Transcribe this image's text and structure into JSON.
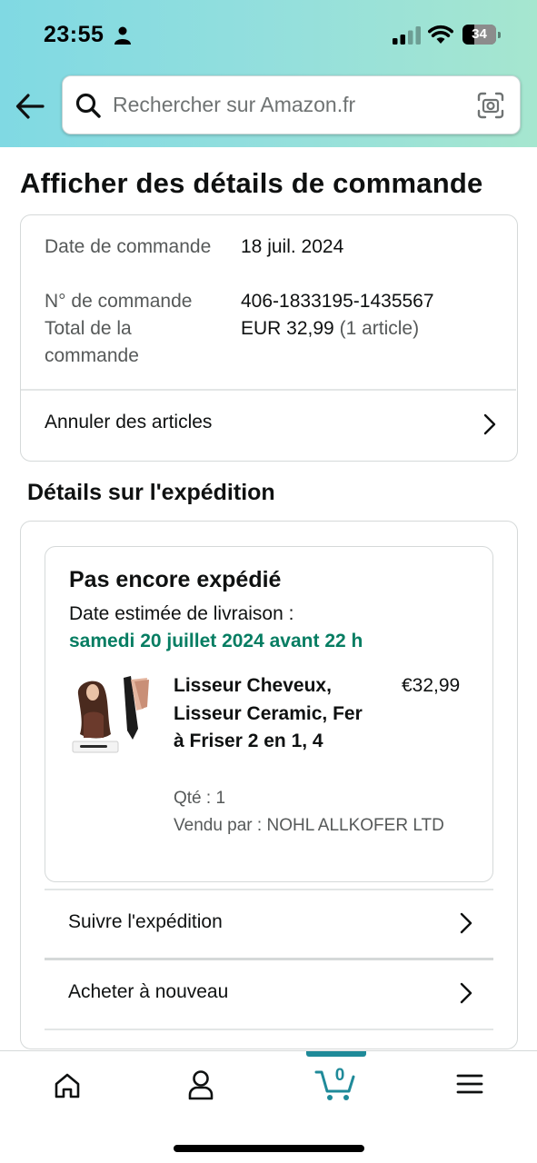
{
  "status_bar": {
    "time": "23:55",
    "battery": "34"
  },
  "search": {
    "placeholder": "Rechercher sur Amazon.fr"
  },
  "page": {
    "title": "Afficher des détails de commande"
  },
  "order_summary": {
    "date_label": "Date de commande",
    "date_value": "18 juil. 2024",
    "number_label": "N° de commande",
    "number_value": "406-1833195-1435567",
    "total_label": "Total de la commande",
    "total_value": "EUR 32,99",
    "total_items": "(1 article)",
    "cancel_label": "Annuler des articles"
  },
  "shipment": {
    "section_title": "Détails sur l'expédition",
    "status": "Pas encore expédié",
    "delivery_label": "Date estimée de livraison :",
    "delivery_date": "samedi 20 juillet 2024 avant 22 h",
    "product": {
      "title": "Lisseur Cheveux, Lisseur Ceramic, Fer à Friser 2 en 1, 4",
      "price": "€32,99",
      "quantity": "Qté : 1",
      "seller": "Vendu par : NOHL ALLKOFER LTD"
    },
    "track_label": "Suivre l'expédition",
    "buy_again_label": "Acheter à nouveau"
  },
  "tabbar": {
    "items": [
      {
        "name": "home",
        "icon": "home-icon"
      },
      {
        "name": "account",
        "icon": "person-icon"
      },
      {
        "name": "cart",
        "icon": "cart-icon",
        "count": "0",
        "active": true
      },
      {
        "name": "menu",
        "icon": "hamburger-menu-icon"
      }
    ],
    "accent_color": "#1f8a99"
  },
  "colors": {
    "delivery_green": "#067d62",
    "header_gradient_start": "#80d9e3",
    "header_gradient_end": "#a6e6cf"
  }
}
